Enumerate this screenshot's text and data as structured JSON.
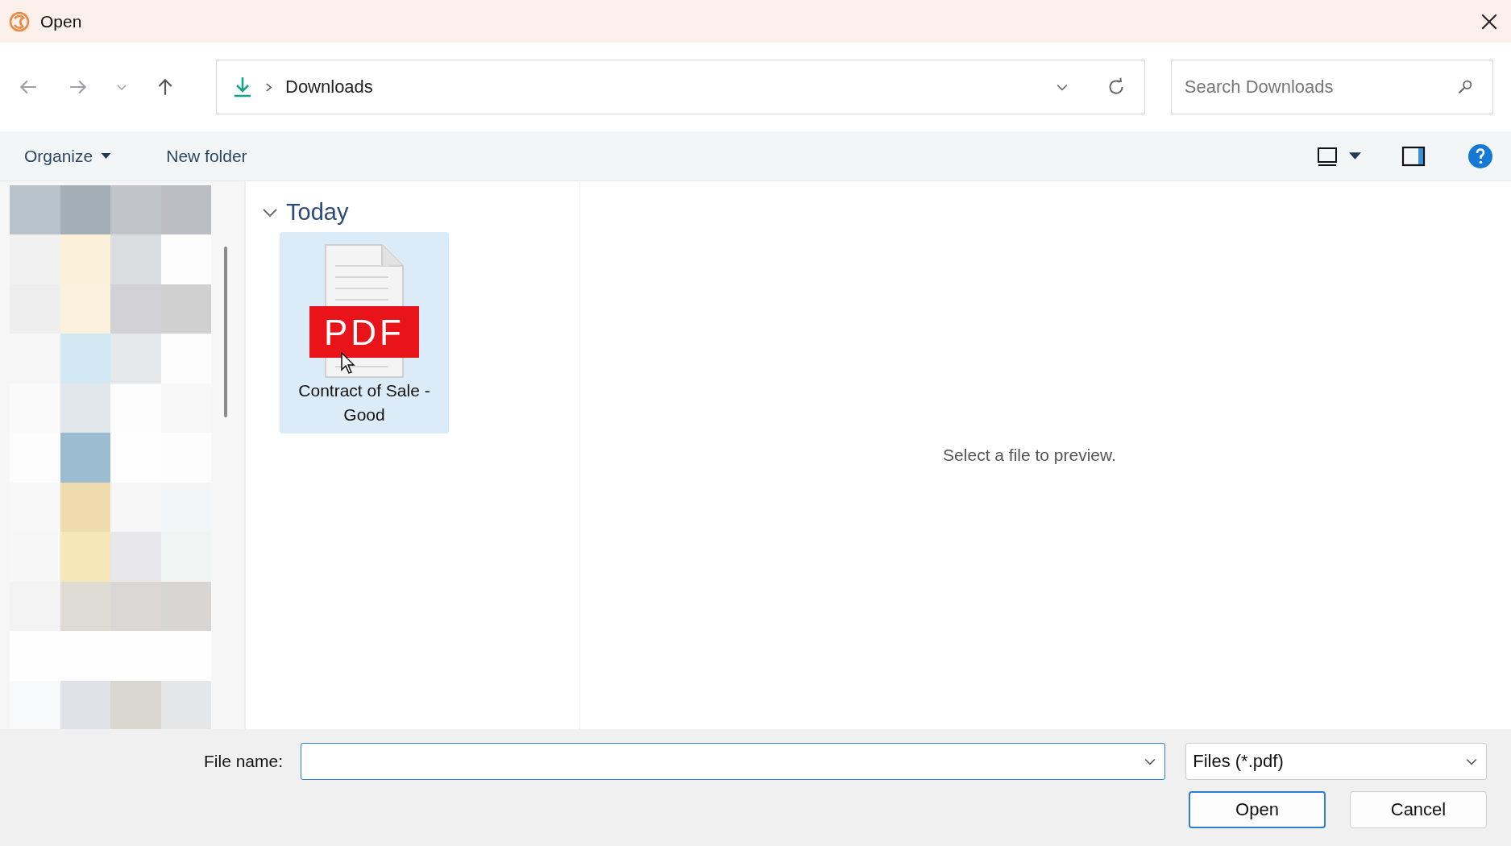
{
  "window": {
    "title": "Open"
  },
  "address": {
    "location": "Downloads"
  },
  "search": {
    "placeholder": "Search Downloads"
  },
  "toolbar": {
    "organize": "Organize",
    "new_folder": "New folder"
  },
  "groups": [
    {
      "label": "Today",
      "expanded": true,
      "files": [
        {
          "name": "Contract of Sale - Good",
          "badge": "PDF",
          "selected": true
        }
      ]
    }
  ],
  "preview": {
    "message": "Select a file to preview."
  },
  "file_name": {
    "label": "File name:"
  },
  "file_type": {
    "value": "Files (*.pdf)"
  },
  "buttons": [
    {
      "label": "Open",
      "default": true
    },
    {
      "label": "Cancel",
      "default": false
    }
  ]
}
